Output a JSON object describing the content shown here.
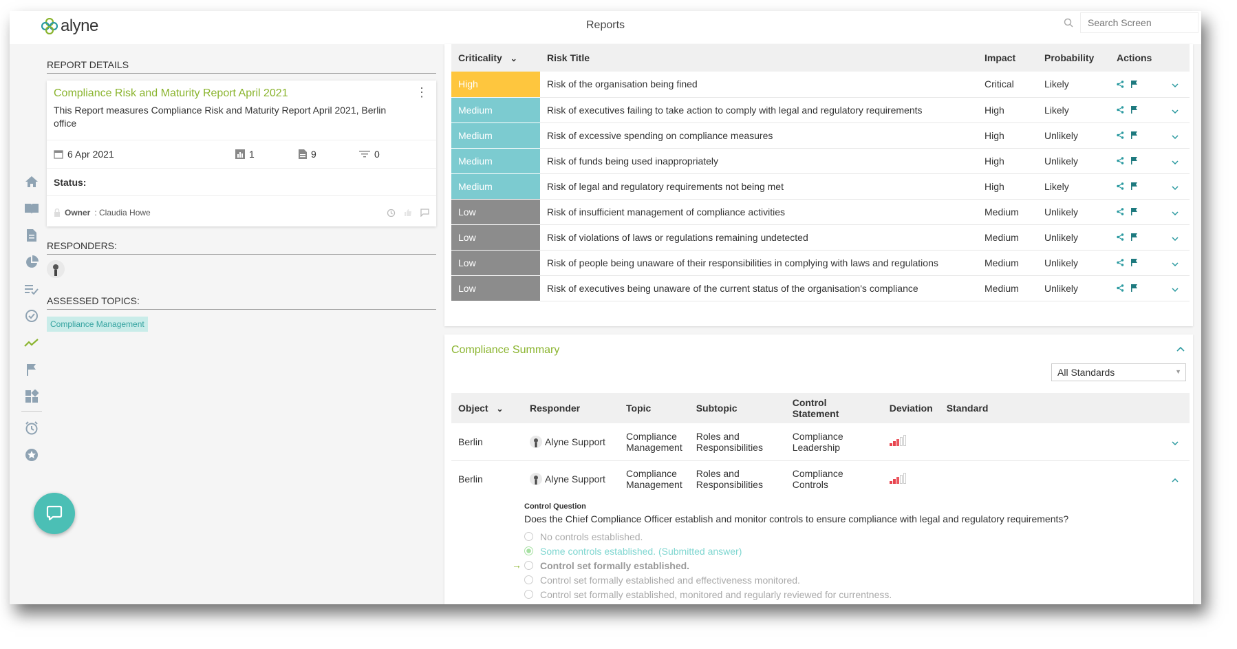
{
  "app": {
    "logo_text": "alyne",
    "page_title": "Reports"
  },
  "search": {
    "placeholder": "Search Screen"
  },
  "sidebar": {
    "items": [
      "home",
      "book",
      "document",
      "pie-chart",
      "checklist",
      "refresh-check",
      "trend",
      "flag",
      "widgets",
      "alarm",
      "star"
    ]
  },
  "report_details": {
    "section_title": "REPORT DETAILS",
    "title": "Compliance Risk and Maturity Report April 2021",
    "description": "This Report measures Compliance Risk and Maturity Report April 2021, Berlin office",
    "date": "6 Apr 2021",
    "charts_count": "1",
    "docs_count": "9",
    "filters_count": "0",
    "status_label": "Status:",
    "owner_label": "Owner",
    "owner_name": ": Claudia Howe"
  },
  "responders": {
    "section_title": "RESPONDERS:"
  },
  "assessed_topics": {
    "section_title": "ASSESSED TOPICS:",
    "tags": [
      "Compliance Management"
    ]
  },
  "risk_table": {
    "headers": {
      "criticality": "Criticality",
      "title": "Risk Title",
      "impact": "Impact",
      "probability": "Probability",
      "actions": "Actions"
    },
    "rows": [
      {
        "criticality": "High",
        "title": "Risk of the organisation being fined",
        "impact": "Critical",
        "probability": "Likely"
      },
      {
        "criticality": "Medium",
        "title": "Risk of executives failing to take action to comply with legal and regulatory requirements",
        "impact": "High",
        "probability": "Likely"
      },
      {
        "criticality": "Medium",
        "title": "Risk of excessive spending on compliance measures",
        "impact": "High",
        "probability": "Unlikely"
      },
      {
        "criticality": "Medium",
        "title": "Risk of funds being used inappropriately",
        "impact": "High",
        "probability": "Unlikely"
      },
      {
        "criticality": "Medium",
        "title": "Risk of legal and regulatory requirements not being met",
        "impact": "High",
        "probability": "Likely"
      },
      {
        "criticality": "Low",
        "title": "Risk of insufficient management of compliance activities",
        "impact": "Medium",
        "probability": "Unlikely"
      },
      {
        "criticality": "Low",
        "title": "Risk of violations of laws or regulations remaining undetected",
        "impact": "Medium",
        "probability": "Unlikely"
      },
      {
        "criticality": "Low",
        "title": "Risk of people being unaware of their responsibilities in complying with laws and regulations",
        "impact": "Medium",
        "probability": "Unlikely"
      },
      {
        "criticality": "Low",
        "title": "Risk of executives being unaware of the current status of the organisation's compliance",
        "impact": "Medium",
        "probability": "Unlikely"
      }
    ]
  },
  "compliance_summary": {
    "title": "Compliance Summary",
    "filter_value": "All Standards",
    "headers": {
      "object": "Object",
      "responder": "Responder",
      "topic": "Topic",
      "subtopic": "Subtopic",
      "control_statement": "Control Statement",
      "deviation": "Deviation",
      "standard": "Standard"
    },
    "rows": [
      {
        "object": "Berlin",
        "responder": "Alyne Support",
        "topic": "Compliance Management",
        "subtopic": "Roles and Responsibilities",
        "control_statement": "Compliance Leadership",
        "standard": ""
      },
      {
        "object": "Berlin",
        "responder": "Alyne Support",
        "topic": "Compliance Management",
        "subtopic": "Roles and Responsibilities",
        "control_statement": "Compliance Controls",
        "standard": ""
      }
    ],
    "control_question_label": "Control Question",
    "control_question": "Does the Chief Compliance Officer establish and monitor controls to ensure compliance with legal and regulatory requirements?",
    "options": [
      "No controls established.",
      "Some controls established. (Submitted answer)",
      "Control set formally established.",
      "Control set formally established and effectiveness monitored.",
      "Control set formally established, monitored and regularly reviewed for currentness."
    ]
  },
  "colors": {
    "accent_green": "#8ab42e",
    "teal": "#2b9aa0",
    "high": "#fec63e",
    "medium": "#7ccbd0",
    "low": "#8c8c8c"
  }
}
